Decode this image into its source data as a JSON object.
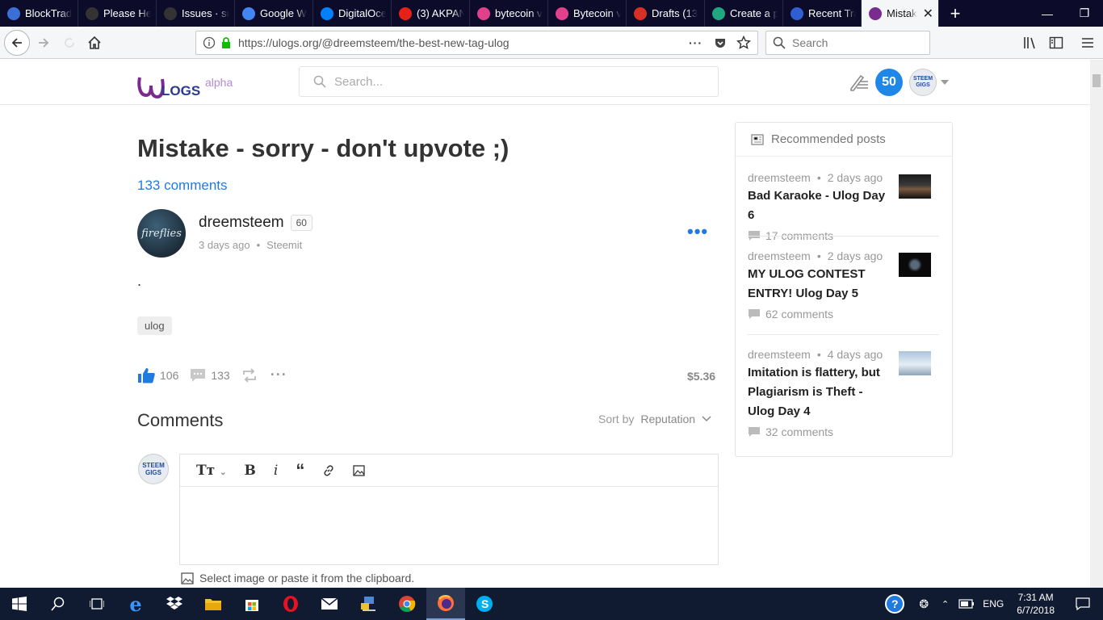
{
  "browser": {
    "tabs": [
      {
        "title": "BlockTrad",
        "icon": "blocktrades-icon",
        "color": "#3b6fd8"
      },
      {
        "title": "Please Hel",
        "icon": "github-icon",
        "color": "#333333"
      },
      {
        "title": "Issues · su",
        "icon": "github-icon",
        "color": "#333333"
      },
      {
        "title": "Google W",
        "icon": "google-icon",
        "color": "#4285f4"
      },
      {
        "title": "DigitalOce",
        "icon": "digitalocean-icon",
        "color": "#0080ff"
      },
      {
        "title": "(3) AKPAN",
        "icon": "youtube-icon",
        "color": "#e62117"
      },
      {
        "title": "bytecoin v",
        "icon": "bytecoin-icon",
        "color": "#e0408c"
      },
      {
        "title": "Bytecoin v",
        "icon": "bytecoin-icon",
        "color": "#e0408c"
      },
      {
        "title": "Drafts (13",
        "icon": "gmail-icon",
        "color": "#d93025"
      },
      {
        "title": "Create a p",
        "icon": "create-icon",
        "color": "#1fa77f"
      },
      {
        "title": "Recent Tra",
        "icon": "recent-icon",
        "color": "#2f5fd0"
      },
      {
        "title": "Mistak",
        "icon": "ulogs-icon",
        "color": "#7a2c8e",
        "active": true
      }
    ],
    "url": "https://ulogs.org/@dreemsteem/the-best-new-tag-ulog",
    "search_placeholder": "Search"
  },
  "site": {
    "logo": "ULOGS",
    "logo_suffix": "alpha",
    "search_placeholder": "Search...",
    "notifications_count": "50",
    "avatar_text": "STEEM GIGS"
  },
  "post": {
    "title": "Mistake - sorry - don't upvote ;)",
    "comments_link": "133 comments",
    "author": "dreemsteem",
    "reputation": "60",
    "time": "3 days ago",
    "separator": "•",
    "app": "Steemit",
    "body": ".",
    "tag": "ulog",
    "likes": "106",
    "comments": "133",
    "payout": "$5.36"
  },
  "comments_section": {
    "heading": "Comments",
    "sort_label": "Sort by",
    "sort_value": "Reputation",
    "image_hint": "Select image or paste it from the clipboard."
  },
  "sidebar": {
    "heading": "Recommended posts",
    "posts": [
      {
        "author": "dreemsteem",
        "time": "2 days ago",
        "title": "Bad Karaoke - Ulog Day 6",
        "comments": "17 comments"
      },
      {
        "author": "dreemsteem",
        "time": "2 days ago",
        "title": "MY ULOG CONTEST ENTRY! Ulog Day 5",
        "comments": "62 comments"
      },
      {
        "author": "dreemsteem",
        "time": "4 days ago",
        "title": "Imitation is flattery, but Plagiarism is Theft - Ulog Day 4",
        "comments": "32 comments"
      }
    ]
  },
  "taskbar": {
    "time": "7:31 AM",
    "date": "6/7/2018",
    "language": "ENG"
  }
}
